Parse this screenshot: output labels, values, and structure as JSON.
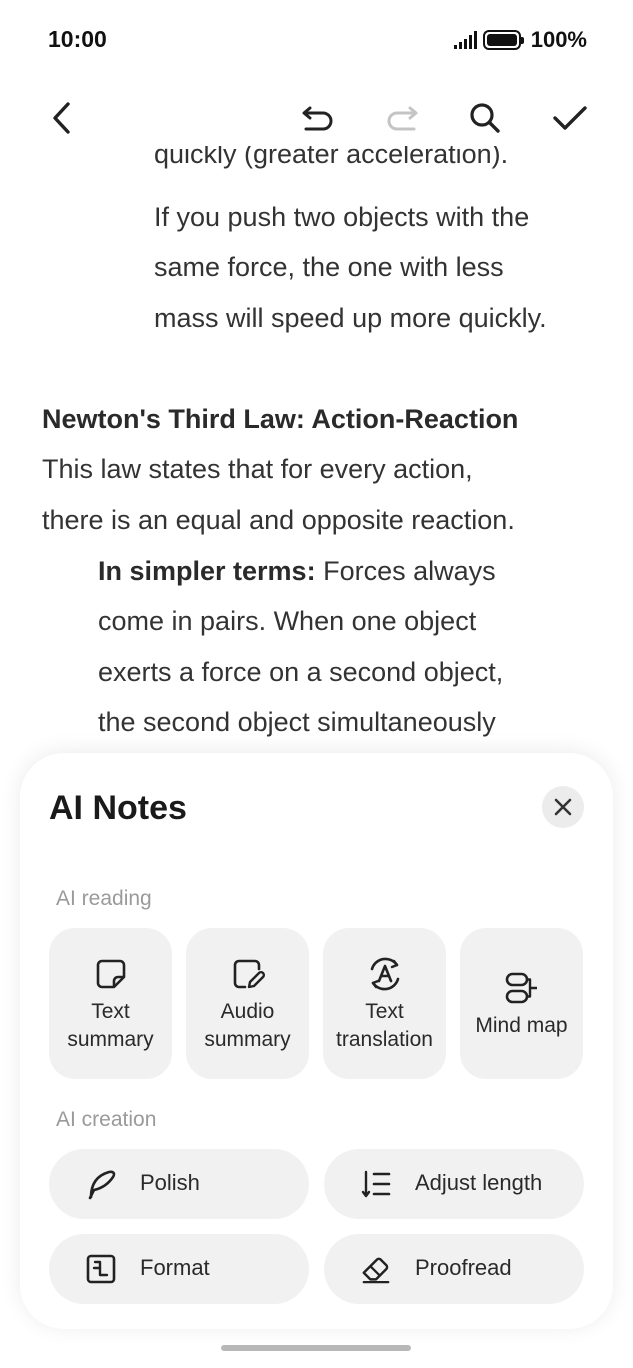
{
  "status": {
    "time": "10:00",
    "battery": "100%"
  },
  "toolbar": {
    "back_icon": "chevron-left-icon",
    "undo_icon": "undo-icon",
    "redo_icon": "redo-icon",
    "search_icon": "search-icon",
    "done_icon": "checkmark-icon"
  },
  "document": {
    "clipped_line": "quickly (greater acceleration).",
    "example_lines": [
      "If you push two objects with the",
      "same force, the one with less",
      "mass will speed up more quickly."
    ],
    "heading": "Newton's Third Law: Action-Reaction",
    "body_lines": [
      "This law states that for every action,",
      "there is an equal and opposite reaction."
    ],
    "simpler_label": "In simpler terms:",
    "simpler_first": " Forces always",
    "simpler_lines": [
      "come in pairs. When one object",
      "exerts a force on a second object,",
      "the second object simultaneously"
    ]
  },
  "sheet": {
    "title": "AI Notes",
    "close_icon": "close-icon",
    "reading_label": "AI reading",
    "reading_items": [
      {
        "label": "Text\nsummary",
        "icon": "text-summary-icon"
      },
      {
        "label": "Audio\nsummary",
        "icon": "audio-summary-icon"
      },
      {
        "label": "Text\ntranslation",
        "icon": "translate-icon"
      },
      {
        "label": "Mind map",
        "icon": "mind-map-icon"
      }
    ],
    "creation_label": "AI creation",
    "creation_items": [
      {
        "label": "Polish",
        "icon": "polish-icon"
      },
      {
        "label": "Adjust length",
        "icon": "adjust-length-icon"
      },
      {
        "label": "Format",
        "icon": "format-icon"
      },
      {
        "label": "Proofread",
        "icon": "proofread-icon"
      }
    ]
  }
}
